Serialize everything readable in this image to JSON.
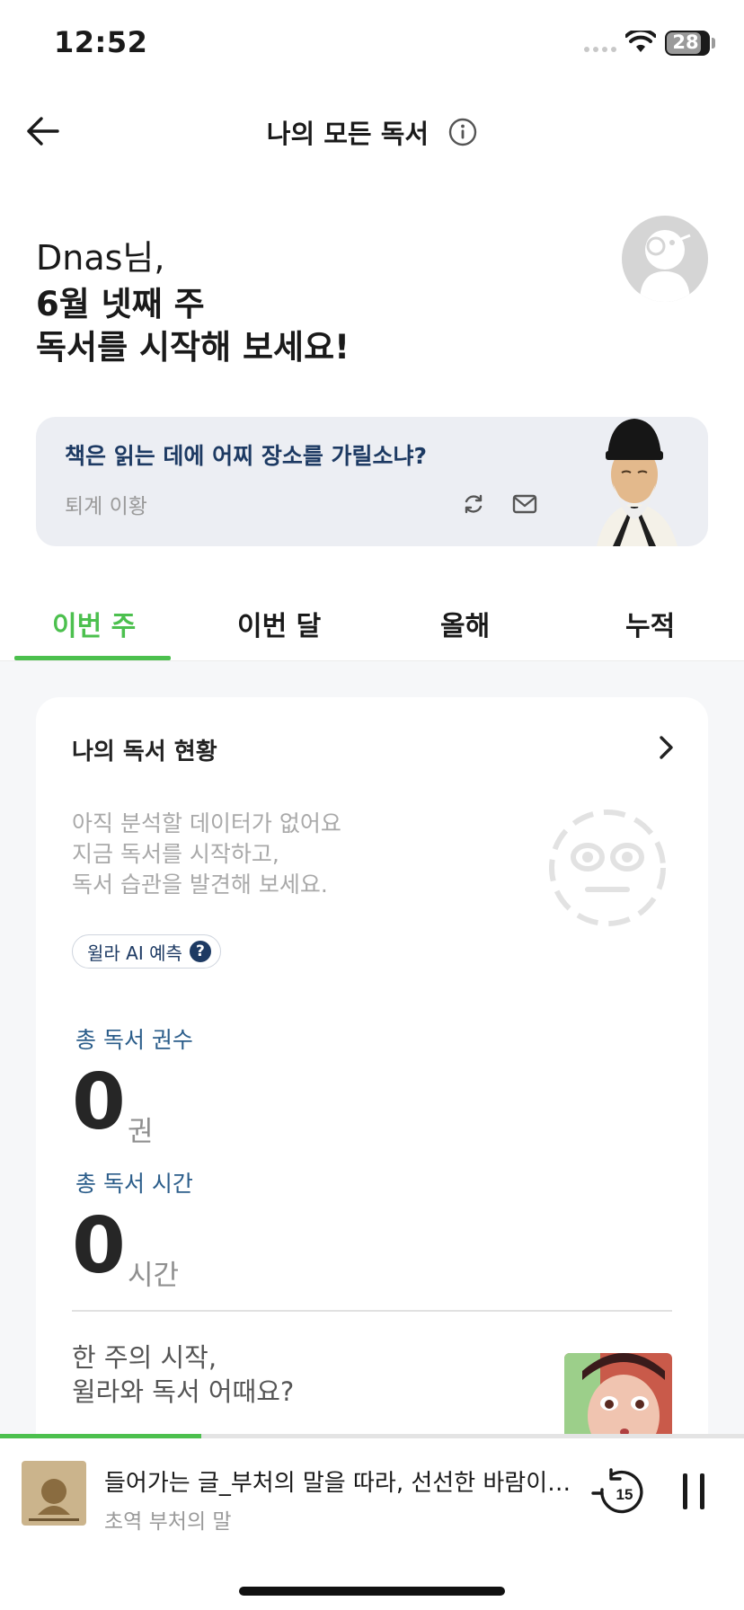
{
  "status_bar": {
    "time": "12:52",
    "battery": "28"
  },
  "header": {
    "title": "나의 모든 독서"
  },
  "greeting": {
    "name": "Dnas님,",
    "line1": "6월 넷째 주",
    "line2": "독서를 시작해 보세요!"
  },
  "quote": {
    "text": "책은 읽는 데에 어찌 장소를 가릴소냐?",
    "author": "퇴계 이황"
  },
  "tabs": [
    {
      "label": "이번 주",
      "active": true
    },
    {
      "label": "이번 달",
      "active": false
    },
    {
      "label": "올해",
      "active": false
    },
    {
      "label": "누적",
      "active": false
    }
  ],
  "reading_status": {
    "title": "나의 독서 현황",
    "empty_lines": [
      "아직 분석할 데이터가 없어요",
      "지금 독서를 시작하고,",
      "독서 습관을 발견해 보세요."
    ],
    "ai_chip": "윌라 AI 예측",
    "ai_help": "?",
    "books": {
      "label": "총 독서 권수",
      "value": "0",
      "unit": "권"
    },
    "time": {
      "label": "총 독서 시간",
      "value": "0",
      "unit": "시간"
    },
    "promo_lines": [
      "한 주의 시작,",
      "윌라와 독서 어때요?"
    ]
  },
  "player": {
    "title": "들어가는 글_부처의 말을 따라, 선선한 바람이…",
    "subtitle": "초역 부처의 말",
    "rewind_seconds": "15",
    "progress": 0.27
  },
  "colors": {
    "accent_green": "#4cc04e",
    "navy": "#1d3a63",
    "stat_label_blue": "#2b5d8a"
  }
}
